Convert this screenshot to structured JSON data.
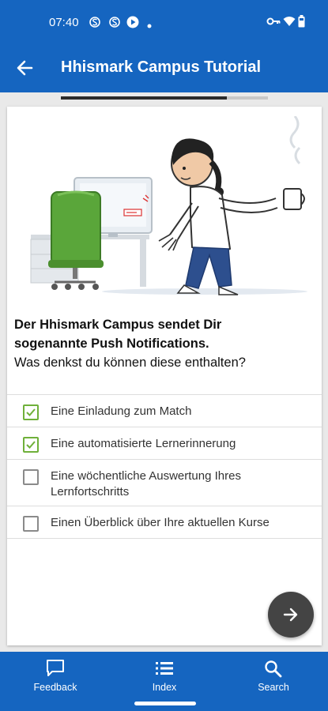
{
  "status_bar": {
    "time": "07:40",
    "left_icons": [
      "notification-s-icon",
      "notification-s-icon",
      "play-icon",
      "dot-icon"
    ],
    "right_icons": [
      "vpn-key-icon",
      "wifi-icon",
      "battery-icon"
    ]
  },
  "app_bar": {
    "title": "Hhismark Campus Tutorial",
    "back_icon": "arrow-back-icon"
  },
  "progress": {
    "fraction": 0.8
  },
  "question": {
    "bold_line1": "Der Hhismark Campus sendet Dir",
    "bold_line2": "sogenannte Push Notifications.",
    "normal": "Was denkst du können diese enthalten?"
  },
  "answers": [
    {
      "label": "Eine Einladung zum Match",
      "checked": true
    },
    {
      "label": "Eine automatisierte Lernerinnerung",
      "checked": true
    },
    {
      "label": "Eine wöchentliche Auswertung Ihres Lernfortschritts",
      "checked": false
    },
    {
      "label": "Einen Überblick über Ihre aktuellen Kurse",
      "checked": false
    }
  ],
  "fab": {
    "icon": "arrow-forward-icon"
  },
  "colors": {
    "primary": "#1565c0",
    "check": "#6fb03a",
    "fab": "#444444"
  },
  "bottom_nav": [
    {
      "label": "Feedback",
      "icon": "feedback-icon"
    },
    {
      "label": "Index",
      "icon": "list-icon"
    },
    {
      "label": "Search",
      "icon": "search-icon"
    }
  ]
}
